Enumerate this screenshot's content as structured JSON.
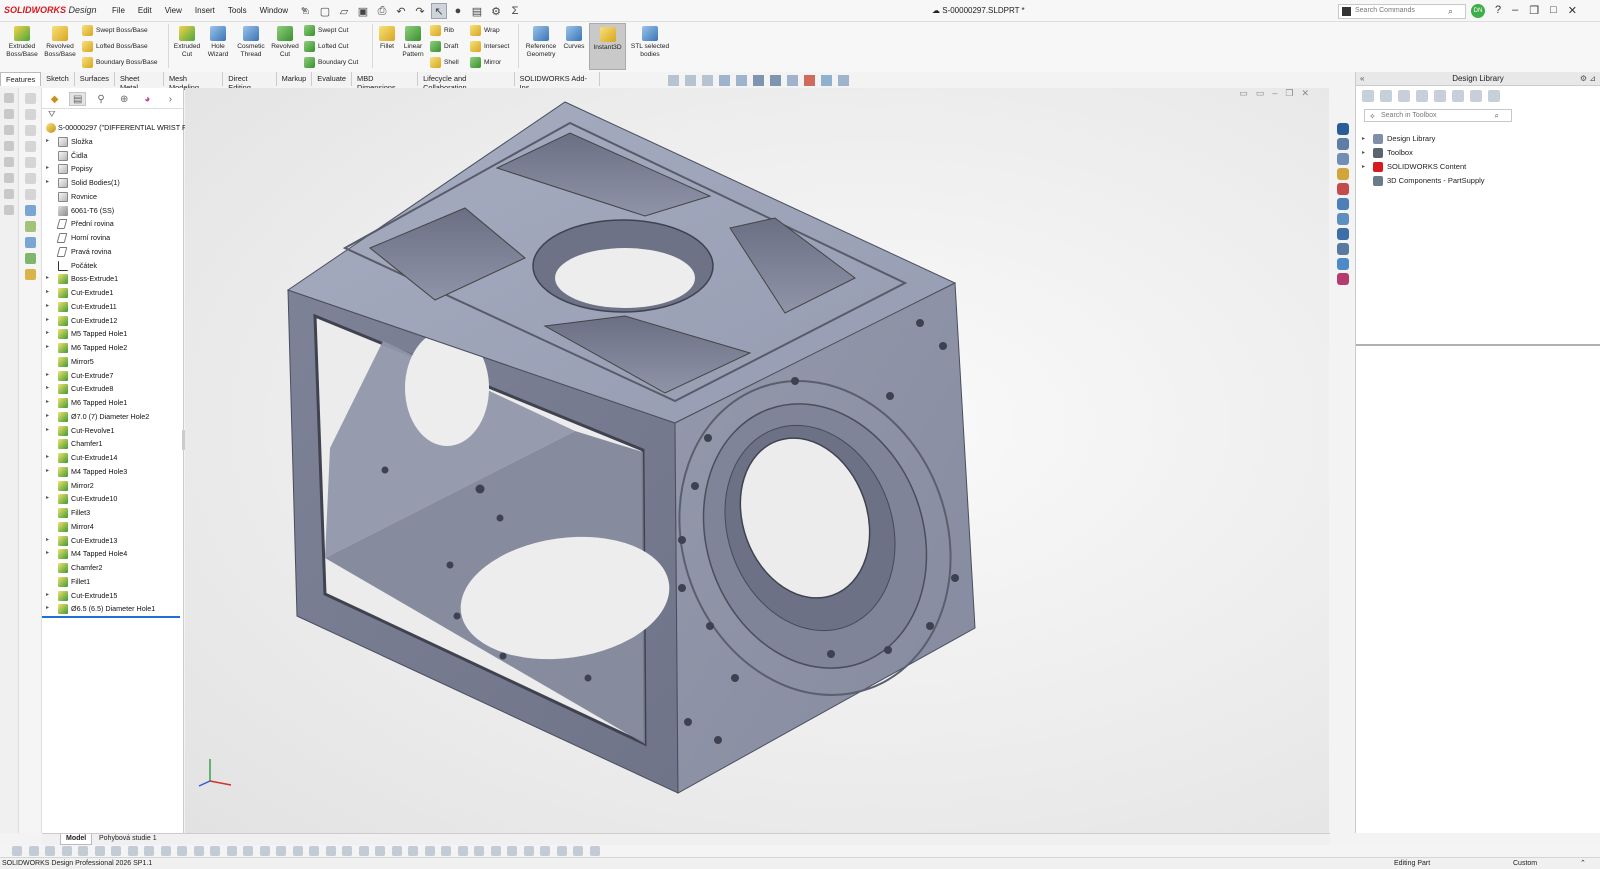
{
  "app": {
    "logo_main": "SOLIDWORKS",
    "logo_sub": "Design",
    "document_title": "S-00000297.SLDPRT *",
    "search_placeholder": "Search Commands",
    "user_initials": "DN",
    "menu": [
      "File",
      "Edit",
      "View",
      "Insert",
      "Tools",
      "Window"
    ]
  },
  "ribbon": {
    "extruded_boss": "Extruded Boss/Base",
    "revolved_boss": "Revolved Boss/Base",
    "swept_boss": "Swept Boss/Base",
    "lofted_boss": "Lofted Boss/Base",
    "boundary_boss": "Boundary Boss/Base",
    "extruded_cut": "Extruded Cut",
    "hole_wizard": "Hole Wizard",
    "cosmetic_thread": "Cosmetic Thread",
    "revolved_cut": "Revolved Cut",
    "swept_cut": "Swept Cut",
    "lofted_cut": "Lofted Cut",
    "boundary_cut": "Boundary Cut",
    "fillet": "Fillet",
    "linear_pattern": "Linear Pattern",
    "rib": "Rib",
    "draft": "Draft",
    "shell": "Shell",
    "wrap": "Wrap",
    "intersect": "Intersect",
    "mirror": "Mirror",
    "reference_geometry": "Reference Geometry",
    "curves": "Curves",
    "instant3d": "Instant3D",
    "stl": "STL selected bodies"
  },
  "command_tabs": [
    "Features",
    "Sketch",
    "Surfaces",
    "Sheet Metal",
    "Mesh Modeling",
    "Direct Editing",
    "Markup",
    "Evaluate",
    "MBD Dimensions",
    "Lifecycle and Collaboration",
    "SOLIDWORKS Add-Ins"
  ],
  "feature_tree": {
    "root": "S-00000297 (\"DIFFERENTIAL WRIST FR",
    "items": [
      {
        "label": "Složka",
        "icon": "folder",
        "expand": true
      },
      {
        "label": "Čidla",
        "icon": "folder",
        "expand": false
      },
      {
        "label": "Popisy",
        "icon": "folder",
        "expand": true
      },
      {
        "label": "Solid Bodies(1)",
        "icon": "folder",
        "expand": true
      },
      {
        "label": "Rovnice",
        "icon": "folder",
        "expand": false
      },
      {
        "label": "6061-T6 (SS)",
        "icon": "material",
        "expand": false
      },
      {
        "label": "Přední rovina",
        "icon": "plane",
        "expand": false
      },
      {
        "label": "Horní rovina",
        "icon": "plane",
        "expand": false
      },
      {
        "label": "Pravá rovina",
        "icon": "plane",
        "expand": false
      },
      {
        "label": "Počátek",
        "icon": "origin",
        "expand": false
      },
      {
        "label": "Boss-Extrude1",
        "icon": "feature",
        "expand": true
      },
      {
        "label": "Cut-Extrude1",
        "icon": "feature",
        "expand": true
      },
      {
        "label": "Cut-Extrude11",
        "icon": "feature",
        "expand": true
      },
      {
        "label": "Cut-Extrude12",
        "icon": "feature",
        "expand": true
      },
      {
        "label": "M5 Tapped Hole1",
        "icon": "feature",
        "expand": true
      },
      {
        "label": "M6 Tapped Hole2",
        "icon": "feature",
        "expand": true
      },
      {
        "label": "Mirror5",
        "icon": "feature",
        "expand": false
      },
      {
        "label": "Cut-Extrude7",
        "icon": "feature",
        "expand": true
      },
      {
        "label": "Cut-Extrude8",
        "icon": "feature",
        "expand": true
      },
      {
        "label": "M6 Tapped Hole1",
        "icon": "feature",
        "expand": true
      },
      {
        "label": "Ø7.0 (7) Diameter Hole2",
        "icon": "feature",
        "expand": true
      },
      {
        "label": "Cut-Revolve1",
        "icon": "feature",
        "expand": true
      },
      {
        "label": "Chamfer1",
        "icon": "feature",
        "expand": false
      },
      {
        "label": "Cut-Extrude14",
        "icon": "feature",
        "expand": true
      },
      {
        "label": "M4 Tapped Hole3",
        "icon": "feature",
        "expand": true
      },
      {
        "label": "Mirror2",
        "icon": "feature",
        "expand": false
      },
      {
        "label": "Cut-Extrude10",
        "icon": "feature",
        "expand": true
      },
      {
        "label": "Fillet3",
        "icon": "feature",
        "expand": false
      },
      {
        "label": "Mirror4",
        "icon": "feature",
        "expand": false
      },
      {
        "label": "Cut-Extrude13",
        "icon": "feature",
        "expand": true
      },
      {
        "label": "M4 Tapped Hole4",
        "icon": "feature",
        "expand": true
      },
      {
        "label": "Chamfer2",
        "icon": "feature",
        "expand": false
      },
      {
        "label": "Fillet1",
        "icon": "feature",
        "expand": false
      },
      {
        "label": "Cut-Extrude15",
        "icon": "feature",
        "expand": true
      },
      {
        "label": "Ø6.5 (6.5) Diameter Hole1",
        "icon": "feature",
        "expand": true
      }
    ]
  },
  "design_library": {
    "title": "Design Library",
    "search_placeholder": "Search in Toolbox",
    "items": [
      {
        "label": "Design Library",
        "expand": true,
        "color": "#7f8fa8"
      },
      {
        "label": "Toolbox",
        "expand": true,
        "color": "#5b6470"
      },
      {
        "label": "SOLIDWORKS Content",
        "expand": true,
        "color": "#d71920"
      },
      {
        "label": "3D Components - PartSupply",
        "expand": false,
        "color": "#6a7a8a"
      }
    ]
  },
  "bottom_tabs": [
    "Model",
    "Pohybová studie 1"
  ],
  "status": {
    "left": "SOLIDWORKS Design Professional 2026 SP1.1",
    "mode": "Editing Part",
    "units": "Custom"
  },
  "colors": {
    "part_face_top": "#9ea4b8",
    "part_face_left": "#7b8094",
    "part_face_right": "#8e93a6",
    "brand_red": "#d71920"
  }
}
